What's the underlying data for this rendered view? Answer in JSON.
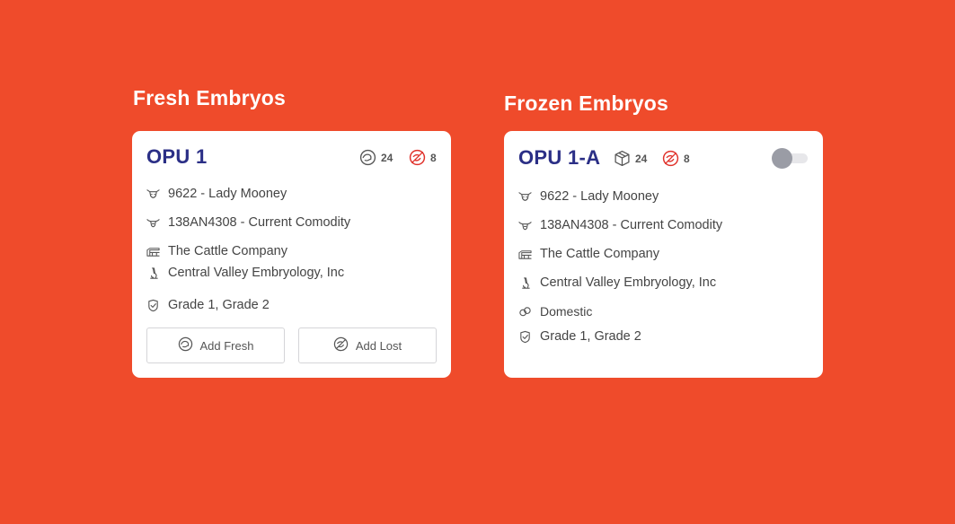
{
  "fresh": {
    "heading": "Fresh Embryos",
    "card": {
      "title": "OPU 1",
      "stats": [
        {
          "icon": "embryo-hand-icon",
          "value": "24"
        },
        {
          "icon": "lost-embryo-icon",
          "value": "8"
        }
      ],
      "rows": [
        {
          "icon": "cow-icon",
          "text": "9622 - Lady Mooney"
        },
        {
          "icon": "bull-icon",
          "text": "138AN4308 - Current Comodity"
        },
        {
          "icon": "barn-icon",
          "text": "The Cattle Company"
        },
        {
          "icon": "microscope-icon",
          "text": "Central Valley Embryology, Inc"
        },
        {
          "icon": "shield-check-icon",
          "text": "Grade 1, Grade 2"
        }
      ],
      "buttons": {
        "add_fresh": "Add Fresh",
        "add_lost": "Add Lost"
      }
    }
  },
  "frozen": {
    "heading": "Frozen Embryos",
    "card": {
      "title": "OPU 1-A",
      "stats": [
        {
          "icon": "box-icon",
          "value": "24"
        },
        {
          "icon": "lost-embryo-icon",
          "value": "8"
        }
      ],
      "toggle_on": false,
      "rows": [
        {
          "icon": "cow-icon",
          "text": "9622 - Lady Mooney"
        },
        {
          "icon": "bull-icon",
          "text": "138AN4308 - Current Comodity"
        },
        {
          "icon": "barn-icon",
          "text": "The Cattle Company"
        },
        {
          "icon": "microscope-icon",
          "text": "Central Valley Embryology, Inc"
        },
        {
          "icon": "link-icon",
          "text": "Domestic"
        },
        {
          "icon": "shield-check-icon",
          "text": "Grade 1, Grade 2"
        }
      ]
    }
  },
  "colors": {
    "background": "#ef4b2b",
    "title": "#2b2f86",
    "lost_red": "#e0312a"
  }
}
